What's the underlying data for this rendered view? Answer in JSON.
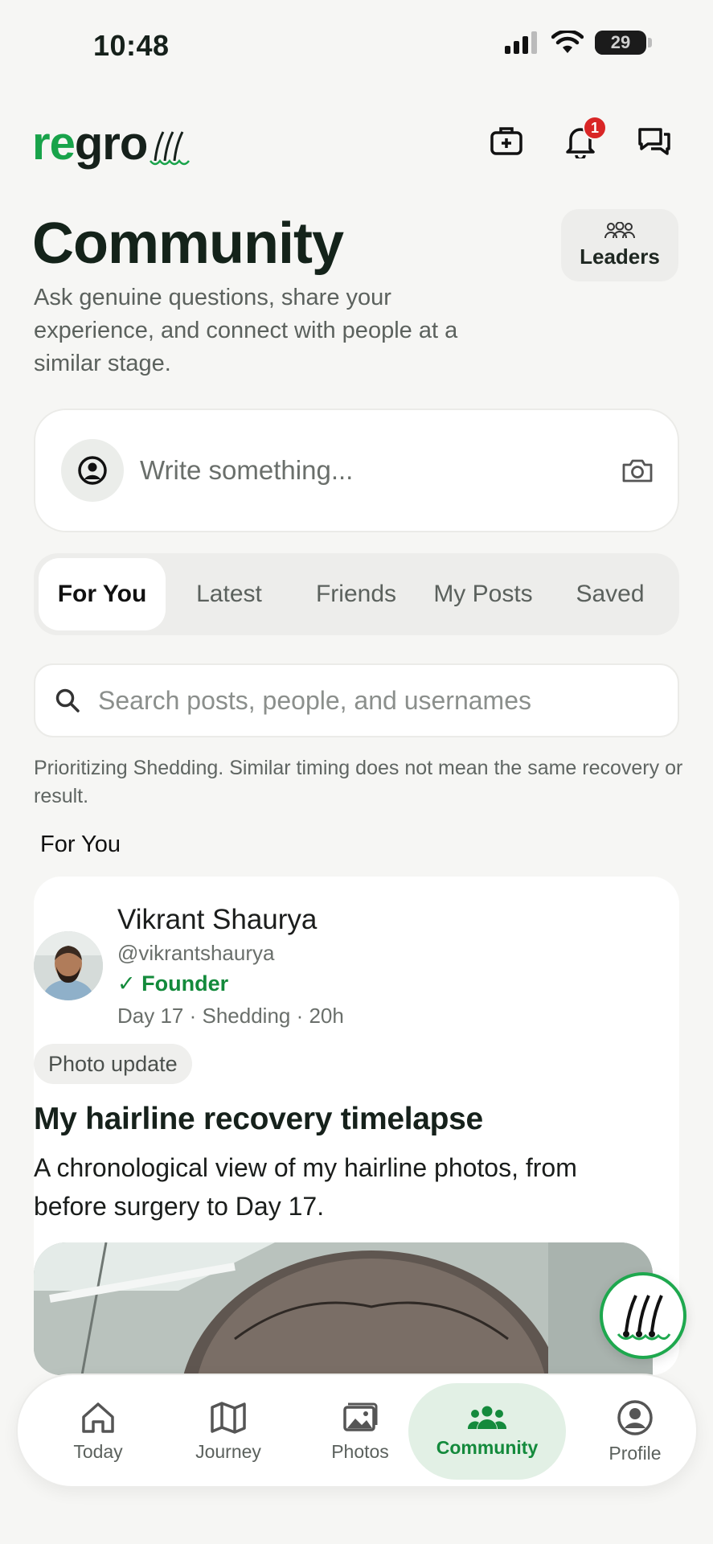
{
  "status_bar": {
    "time": "10:48",
    "battery": "29"
  },
  "header": {
    "logo_text_green": "re",
    "logo_text_dark": "gro",
    "notifications_count": "1"
  },
  "page": {
    "title": "Community",
    "subtitle": "Ask genuine questions, share your experience, and connect with people at a similar stage.",
    "leaders_label": "Leaders"
  },
  "composer": {
    "placeholder": "Write something..."
  },
  "tabs": [
    {
      "label": "For You",
      "active": true
    },
    {
      "label": "Latest",
      "active": false
    },
    {
      "label": "Friends",
      "active": false
    },
    {
      "label": "My Posts",
      "active": false
    },
    {
      "label": "Saved",
      "active": false
    }
  ],
  "search": {
    "placeholder": "Search posts, people, and usernames"
  },
  "note": "Prioritizing Shedding. Similar timing does not mean the same recovery or result.",
  "section_label": "For You",
  "post": {
    "author": "Vikrant Shaurya",
    "handle": "@vikrantshaurya",
    "role": "✓ Founder",
    "meta": "Day 17 · Shedding · 20h",
    "tag": "Photo update",
    "title": "My hairline recovery timelapse",
    "body": "A chronological view of my hairline photos, from before surgery to Day 17."
  },
  "bottom_nav": [
    {
      "label": "Today",
      "icon": "home-icon",
      "active": false
    },
    {
      "label": "Journey",
      "icon": "map-icon",
      "active": false
    },
    {
      "label": "Photos",
      "icon": "photos-icon",
      "active": false
    },
    {
      "label": "Community",
      "icon": "community-icon",
      "active": true
    },
    {
      "label": "Profile",
      "icon": "profile-icon",
      "active": false
    }
  ],
  "colors": {
    "accent": "#18a34a",
    "accent_dark": "#138a3b",
    "badge": "#d92626",
    "background": "#f6f6f4"
  }
}
